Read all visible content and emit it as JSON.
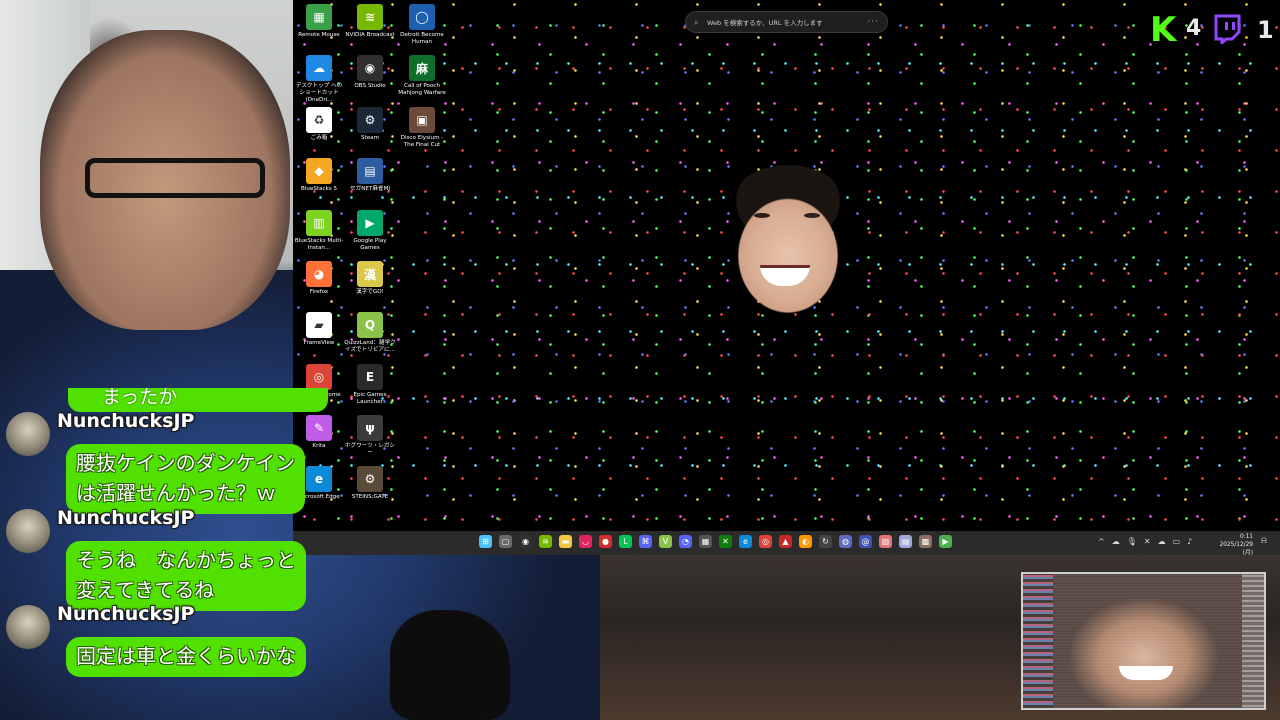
{
  "search": {
    "placeholder": "Web を検索するか、URL を入力します"
  },
  "desktop_icons": [
    {
      "label": "Remote Mouse",
      "color": "#3aa04a",
      "glyph": "▦"
    },
    {
      "label": "NVIDIA Broadcast",
      "color": "#76b900",
      "glyph": "≋"
    },
    {
      "label": "Detroit Become Human",
      "color": "#1e5fb0",
      "glyph": "◯"
    },
    {
      "label": "デスクトップ へのショートカット (OneDri...",
      "color": "#1e88e5",
      "glyph": "☁"
    },
    {
      "label": "OBS Studio",
      "color": "#302e31",
      "glyph": "◉"
    },
    {
      "label": "Call of Pooch Mahjong Warfare",
      "color": "#0f6e2a",
      "glyph": "麻"
    },
    {
      "label": "ごみ箱",
      "color": "#ffffff",
      "glyph": "♻"
    },
    {
      "label": "Steam",
      "color": "#1b2838",
      "glyph": "⚙"
    },
    {
      "label": "Disco Elysium - The Final Cut",
      "color": "#6b4a3a",
      "glyph": "▣"
    },
    {
      "label": "BlueStacks 5",
      "color": "#f5a623",
      "glyph": "◆"
    },
    {
      "label": "セガNET麻雀MJ",
      "color": "#2d5c9f",
      "glyph": "▤"
    },
    {
      "label": "BlueStacks Multi-Instan...",
      "color": "#7ed321",
      "glyph": "▥"
    },
    {
      "label": "Google Play Games",
      "color": "#00a86b",
      "glyph": "▶"
    },
    {
      "label": "Firefox",
      "color": "#ff7139",
      "glyph": "◕"
    },
    {
      "label": "漢字でGO!",
      "color": "#d9c84a",
      "glyph": "漢"
    },
    {
      "label": "FrameView",
      "color": "#ffffff",
      "glyph": "▰"
    },
    {
      "label": "QuizzLand：雑学クイズでトリビアに...",
      "color": "#8bc34a",
      "glyph": "Q"
    },
    {
      "label": "Google Chrome",
      "color": "#db4437",
      "glyph": "◎"
    },
    {
      "label": "Epic Games Launcher",
      "color": "#2a2a2a",
      "glyph": "E"
    },
    {
      "label": "Krita",
      "color": "#c05de8",
      "glyph": "✎"
    },
    {
      "label": "ホグワーツ・レガシー",
      "color": "#3b3b3b",
      "glyph": "ψ"
    },
    {
      "label": "Microsoft Edge",
      "color": "#0c8ad8",
      "glyph": "e"
    },
    {
      "label": "STEINS;GATE",
      "color": "#5a4a3a",
      "glyph": "⚙"
    }
  ],
  "taskbar": {
    "icons": [
      {
        "name": "start",
        "color": "#4cc2ff",
        "glyph": "⊞"
      },
      {
        "name": "task-view",
        "color": "#6a6a6a",
        "glyph": "▢"
      },
      {
        "name": "obs",
        "color": "#303030",
        "glyph": "◉"
      },
      {
        "name": "nvidia",
        "color": "#76b900",
        "glyph": "≋"
      },
      {
        "name": "file-explorer",
        "color": "#f4c542",
        "glyph": "▬"
      },
      {
        "name": "lips",
        "color": "#e0245e",
        "glyph": "◡"
      },
      {
        "name": "record",
        "color": "#d32f2f",
        "glyph": "●"
      },
      {
        "name": "line",
        "color": "#06c755",
        "glyph": "L"
      },
      {
        "name": "app",
        "color": "#5865f2",
        "glyph": "⌘"
      },
      {
        "name": "v-app",
        "color": "#8bc34a",
        "glyph": "V"
      },
      {
        "name": "discord",
        "color": "#5865f2",
        "glyph": "◔"
      },
      {
        "name": "app2",
        "color": "#555555",
        "glyph": "▦"
      },
      {
        "name": "xbox",
        "color": "#107c10",
        "glyph": "✕"
      },
      {
        "name": "edge",
        "color": "#0c8ad8",
        "glyph": "e"
      },
      {
        "name": "chrome",
        "color": "#db4437",
        "glyph": "◎"
      },
      {
        "name": "app3",
        "color": "#c62828",
        "glyph": "▲"
      },
      {
        "name": "app4",
        "color": "#ff9800",
        "glyph": "◐"
      },
      {
        "name": "app5",
        "color": "#444444",
        "glyph": "↻"
      },
      {
        "name": "app6",
        "color": "#5c6bc0",
        "glyph": "◍"
      },
      {
        "name": "app7",
        "color": "#3f51b5",
        "glyph": "@"
      },
      {
        "name": "app8",
        "color": "#e57373",
        "glyph": "▨"
      },
      {
        "name": "app9",
        "color": "#9fa8da",
        "glyph": "▤"
      },
      {
        "name": "app10",
        "color": "#8d6e63",
        "glyph": "▩"
      },
      {
        "name": "app11",
        "color": "#4caf50",
        "glyph": "▶"
      }
    ],
    "tray": [
      "^",
      "☁",
      "🎙",
      "✕",
      "☁",
      "▭",
      "♪"
    ],
    "time": "0:11",
    "date": "2025/12/29 (月)"
  },
  "counters": {
    "kick_count": "4",
    "twitch_count": "1",
    "kick_color": "#53fc18",
    "twitch_color": "#9146ff"
  },
  "chat": {
    "partial_text": "まったか",
    "messages": [
      {
        "user": "NunchucksJP",
        "lines": [
          "腰抜ケインのダンケイン",
          "は活躍せんかった？ｗ"
        ]
      },
      {
        "user": "NunchucksJP",
        "lines": [
          "そうね　なんかちょっと",
          "変えてきてるね"
        ]
      },
      {
        "user": "NunchucksJP",
        "lines": [
          "固定は車と金くらいかな"
        ]
      }
    ],
    "bubble_color": "#52e000"
  }
}
